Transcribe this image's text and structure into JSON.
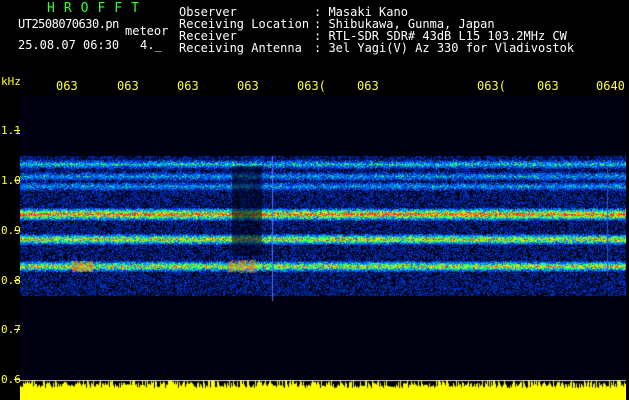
{
  "header": {
    "app_title": "HROFFT",
    "filename": "UT2508070630.pn",
    "event_label": "meteor",
    "datetime": "25.08.07 06:30",
    "counter": "4._"
  },
  "station": {
    "keys": [
      "Observer",
      "Receiving Location",
      "Receiver",
      "Receiving Antenna"
    ],
    "values": [
      ": Masaki Kano",
      ": Shibukawa, Gunma, Japan",
      ": RTL-SDR SDR# 43dB L15 103.2MHz CW",
      ": 3el Yagi(V) Az 330 for Vladivostok"
    ]
  },
  "axis": {
    "unit": "kHz",
    "time_ticks": [
      "063",
      "063",
      "063",
      "063",
      "063(",
      "063",
      "063(",
      "063",
      "0640"
    ],
    "freq_ticks": [
      "1.1",
      "1.0",
      "0.9",
      "0.8",
      "0.7",
      "0.6"
    ]
  },
  "colors": {
    "text": "#ffffff",
    "title": "#33ff33",
    "axis": "#ffff33",
    "background": "#000000",
    "level_fill": "#ffff00"
  }
}
